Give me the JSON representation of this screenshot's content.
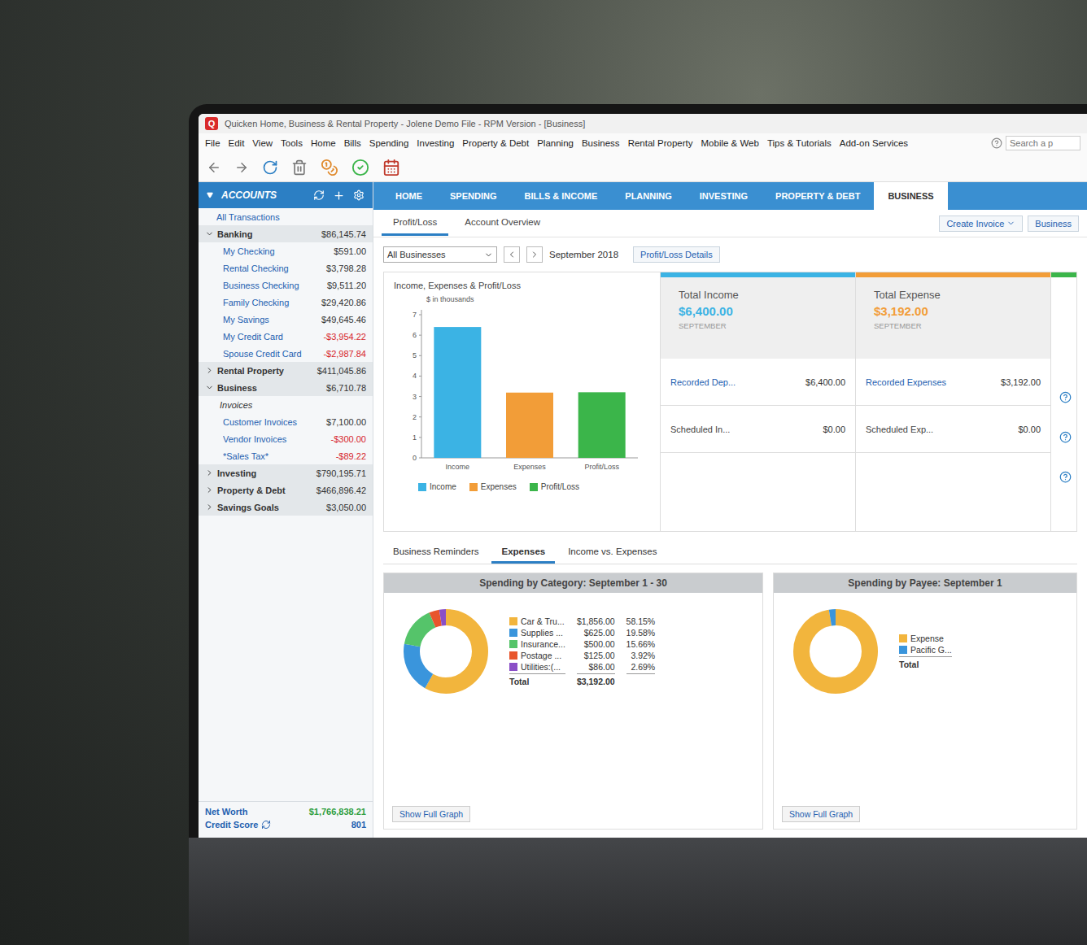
{
  "window": {
    "title": "Quicken Home, Business & Rental Property - Jolene Demo File - RPM Version - [Business]",
    "logo": "Q"
  },
  "menu": [
    "File",
    "Edit",
    "View",
    "Tools",
    "Home",
    "Bills",
    "Spending",
    "Investing",
    "Property & Debt",
    "Planning",
    "Business",
    "Rental Property",
    "Mobile & Web",
    "Tips & Tutorials",
    "Add-on Services"
  ],
  "search": {
    "placeholder": "Search a p"
  },
  "sidebar": {
    "header": "ACCOUNTS",
    "all": "All Transactions",
    "groups": [
      {
        "name": "Banking",
        "total": "$86,145.74",
        "expanded": true,
        "items": [
          {
            "kind": "account",
            "name": "My Checking",
            "amount": "$591.00",
            "negative": false
          },
          {
            "kind": "account",
            "name": "Rental Checking",
            "amount": "$3,798.28",
            "negative": false
          },
          {
            "kind": "account",
            "name": "Business Checking",
            "amount": "$9,511.20",
            "negative": false
          },
          {
            "kind": "account",
            "name": "Family Checking",
            "amount": "$29,420.86",
            "negative": false
          },
          {
            "kind": "account",
            "name": "My Savings",
            "amount": "$49,645.46",
            "negative": false
          },
          {
            "kind": "account",
            "name": "My Credit Card",
            "amount": "-$3,954.22",
            "negative": true
          },
          {
            "kind": "account",
            "name": "Spouse Credit Card",
            "amount": "-$2,987.84",
            "negative": true
          }
        ]
      },
      {
        "name": "Rental Property",
        "total": "$411,045.86",
        "expanded": false,
        "items": []
      },
      {
        "name": "Business",
        "total": "$6,710.78",
        "expanded": true,
        "items": [
          {
            "kind": "subheader",
            "name": "Invoices",
            "amount": "",
            "negative": false
          },
          {
            "kind": "account",
            "name": "Customer Invoices",
            "amount": "$7,100.00",
            "negative": false
          },
          {
            "kind": "account",
            "name": "Vendor Invoices",
            "amount": "-$300.00",
            "negative": true
          },
          {
            "kind": "account",
            "name": "*Sales Tax*",
            "amount": "-$89.22",
            "negative": true
          }
        ]
      },
      {
        "name": "Investing",
        "total": "$790,195.71",
        "expanded": false,
        "items": []
      },
      {
        "name": "Property & Debt",
        "total": "$466,896.42",
        "expanded": false,
        "items": []
      },
      {
        "name": "Savings Goals",
        "total": "$3,050.00",
        "expanded": false,
        "items": []
      }
    ],
    "net_worth": {
      "label": "Net Worth",
      "value": "$1,766,838.21"
    },
    "credit_score": {
      "label": "Credit Score",
      "value": "801"
    }
  },
  "tabs": [
    {
      "label": "HOME",
      "selected": false
    },
    {
      "label": "SPENDING",
      "selected": false
    },
    {
      "label": "BILLS & INCOME",
      "selected": false
    },
    {
      "label": "PLANNING",
      "selected": false
    },
    {
      "label": "INVESTING",
      "selected": false
    },
    {
      "label": "PROPERTY & DEBT",
      "selected": false
    },
    {
      "label": "BUSINESS",
      "selected": true
    }
  ],
  "subtabs": [
    {
      "label": "Profit/Loss",
      "selected": true
    },
    {
      "label": "Account Overview",
      "selected": false
    }
  ],
  "actions": [
    {
      "label": "Create Invoice",
      "dropdown": true
    },
    {
      "label": "Business",
      "dropdown": false
    }
  ],
  "filter": {
    "business": "All Businesses",
    "period": "September 2018",
    "details": "Profit/Loss Details"
  },
  "chart": {
    "title": "Income, Expenses & Profit/Loss",
    "axis_label": "$ in thousands",
    "ticks": [
      "0",
      "1",
      "2",
      "3",
      "4",
      "5",
      "6",
      "7"
    ],
    "max": 7,
    "series": [
      {
        "name": "Income",
        "color": "#3bb3e4",
        "values": [
          6.4
        ]
      },
      {
        "name": "Expenses",
        "color": "#f29d38",
        "values": [
          3.192
        ]
      },
      {
        "name": "Profit/Loss",
        "color": "#3bb54a",
        "values": [
          3.208
        ]
      }
    ]
  },
  "cards": [
    {
      "title": "Total Income",
      "amount": "$6,400.00",
      "period": "SEPTEMBER",
      "color": "#3bb3e4",
      "rows": [
        {
          "label": "Recorded Dep...",
          "value": "$6,400.00",
          "link": true
        },
        {
          "label": "Scheduled In...",
          "value": "$0.00",
          "link": false
        }
      ]
    },
    {
      "title": "Total Expense",
      "amount": "$3,192.00",
      "period": "SEPTEMBER",
      "color": "#f29d38",
      "rows": [
        {
          "label": "Recorded Expenses",
          "value": "$3,192.00",
          "link": true
        },
        {
          "label": "Scheduled Exp...",
          "value": "$0.00",
          "link": false
        }
      ]
    }
  ],
  "third_card": {
    "color": "#3bb54a"
  },
  "bottom_tabs": [
    {
      "label": "Business Reminders",
      "selected": false
    },
    {
      "label": "Expenses",
      "selected": true
    },
    {
      "label": "Income vs. Expenses",
      "selected": false
    }
  ],
  "category_panel": {
    "title": "Spending by Category: September 1 - 30",
    "items": [
      {
        "label": "Car & Tru...",
        "amount": "$1,856.00",
        "percent": "58.15%",
        "value": 1856,
        "color": "#f2b53d"
      },
      {
        "label": "Supplies ...",
        "amount": "$625.00",
        "percent": "19.58%",
        "value": 625,
        "color": "#3a95dc"
      },
      {
        "label": "Insurance...",
        "amount": "$500.00",
        "percent": "15.66%",
        "value": 500,
        "color": "#55c46a"
      },
      {
        "label": "Postage ...",
        "amount": "$125.00",
        "percent": "3.92%",
        "value": 125,
        "color": "#e8552c"
      },
      {
        "label": "Utilities:(...",
        "amount": "$86.00",
        "percent": "2.69%",
        "value": 86,
        "color": "#8a4fc7"
      }
    ],
    "total": {
      "label": "Total",
      "amount": "$3,192.00"
    },
    "link": "Show Full Graph"
  },
  "payee_panel": {
    "title": "Spending by Payee: September 1",
    "items": [
      {
        "label": "Expense",
        "value": 3106,
        "color": "#f2b53d"
      },
      {
        "label": "Pacific G...",
        "value": 86,
        "color": "#3a95dc"
      }
    ],
    "total": {
      "label": "Total"
    },
    "link": "Show Full Graph"
  }
}
